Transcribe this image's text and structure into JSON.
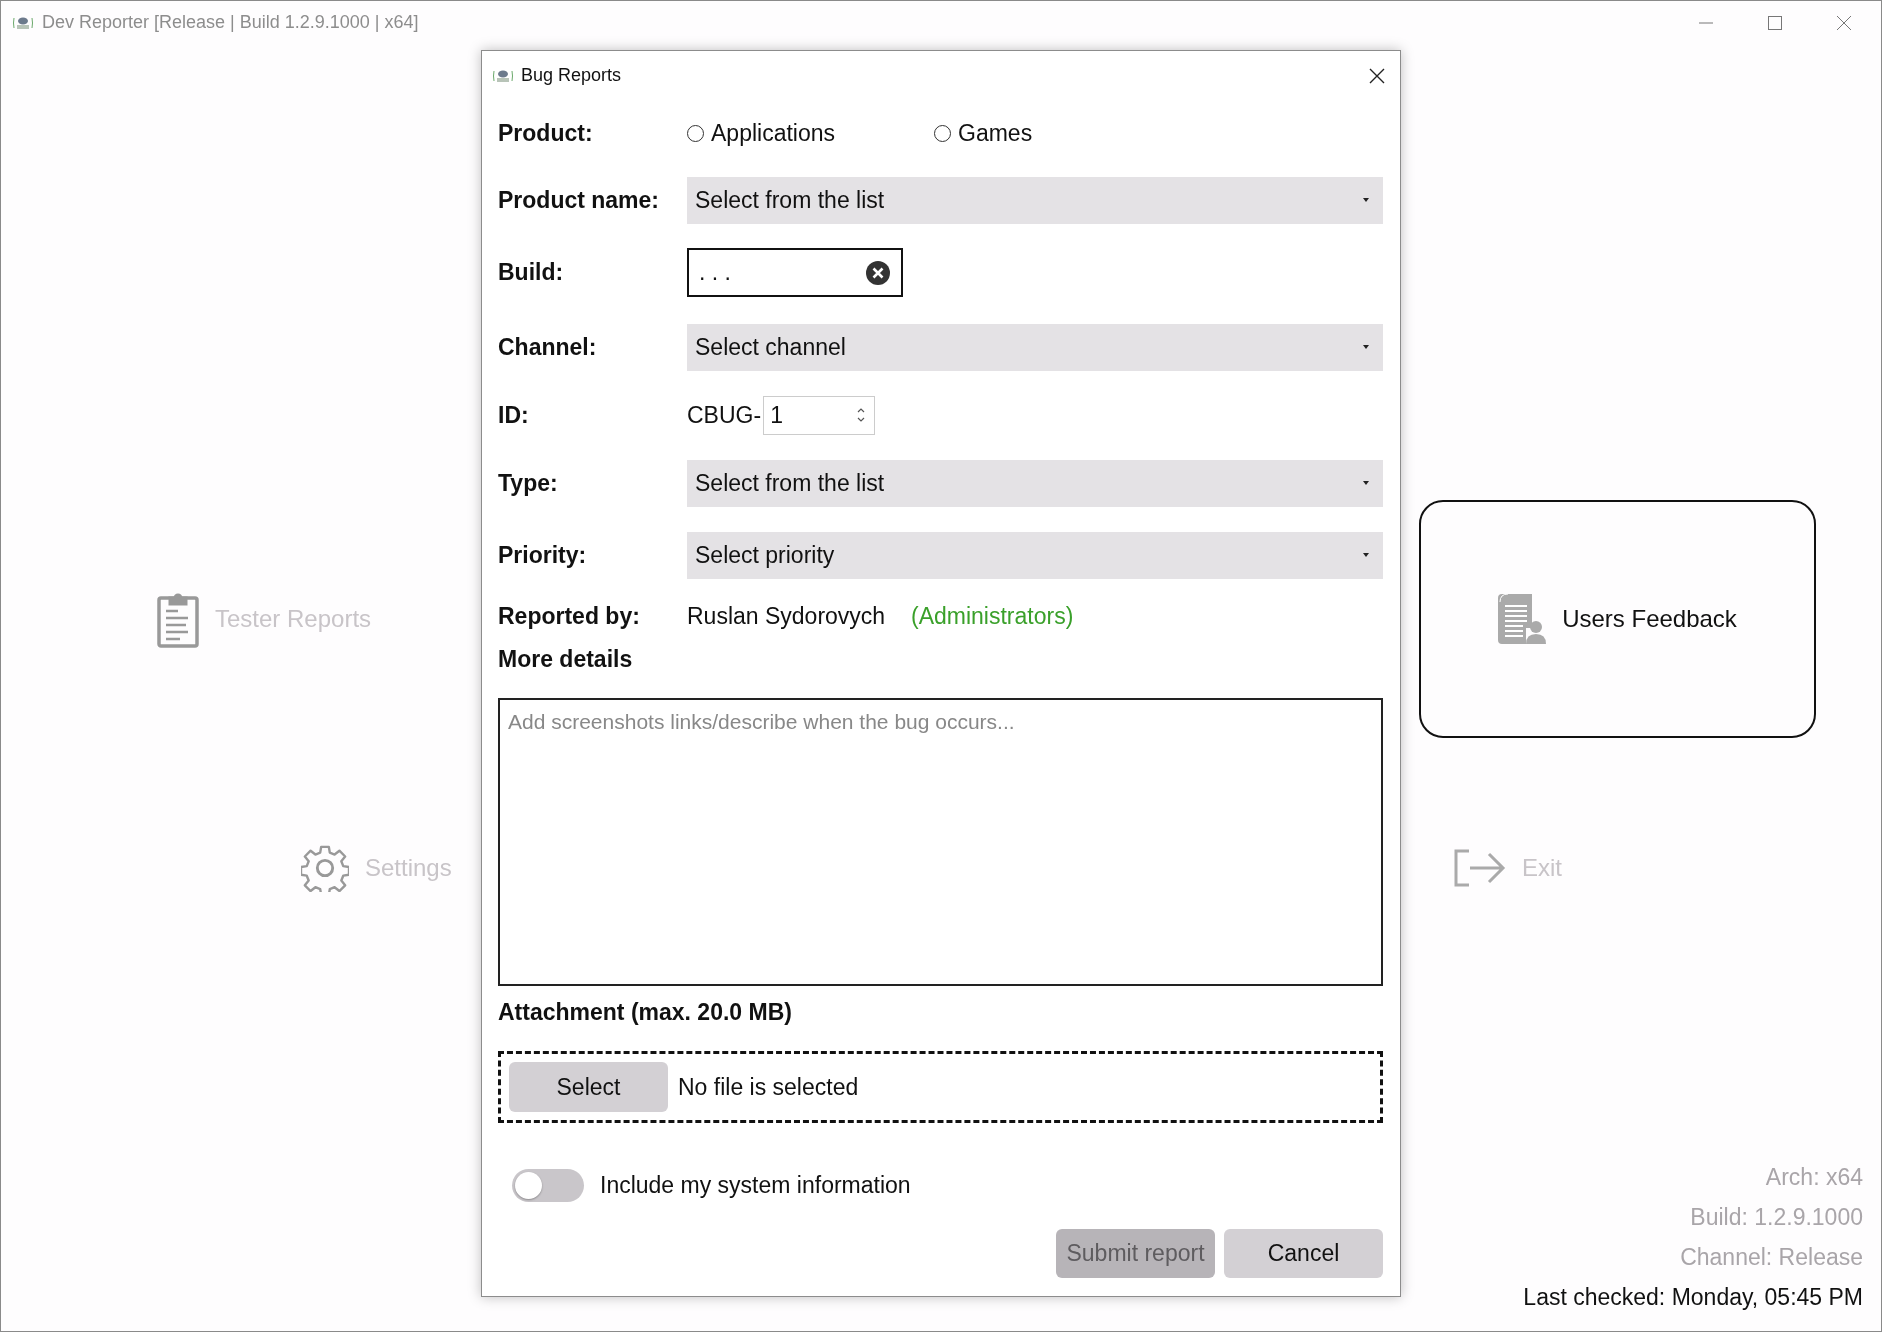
{
  "window": {
    "title": "Dev Reporter [Release | Build 1.2.9.1000 | x64]"
  },
  "tiles": [
    {
      "label": "Tester Reports",
      "kind": "clipboard",
      "selected": false
    },
    {
      "label": "Settings",
      "kind": "gear",
      "selected": false
    },
    {
      "label": "Users Feedback",
      "kind": "feedback",
      "selected": true
    },
    {
      "label": "Exit",
      "kind": "exit",
      "selected": false
    }
  ],
  "info": {
    "arch": "Arch: x64",
    "build": "Build: 1.2.9.1000",
    "channel": "Channel: Release",
    "last_checked": "Last checked: Monday, 05:45 PM"
  },
  "dialog": {
    "title": "Bug Reports",
    "product": {
      "label": "Product:",
      "options": [
        {
          "label": "Applications",
          "selected": false
        },
        {
          "label": "Games",
          "selected": false
        }
      ]
    },
    "product_name": {
      "label": "Product name:",
      "value": "Select from the list"
    },
    "build": {
      "label": "Build:",
      "value": ". . ."
    },
    "channel": {
      "label": "Channel:",
      "value": "Select channel"
    },
    "id": {
      "label": "ID:",
      "prefix": "CBUG-",
      "value": "1"
    },
    "type": {
      "label": "Type:",
      "value": "Select from the list"
    },
    "priority": {
      "label": "Priority:",
      "value": "Select priority"
    },
    "reported_by": {
      "label": "Reported by:",
      "name": "Ruslan Sydorovych",
      "group": "(Administrators)"
    },
    "more_details": {
      "label": "More details",
      "placeholder": "Add screenshots links/describe when the bug occurs..."
    },
    "attachment": {
      "label": "Attachment (max. 20.0 MB)",
      "button": "Select",
      "status": "No file is selected"
    },
    "system_info": {
      "label": "Include my system information",
      "on": false
    },
    "buttons": [
      {
        "label": "Submit report",
        "disabled": true
      },
      {
        "label": "Cancel",
        "disabled": false
      }
    ]
  }
}
